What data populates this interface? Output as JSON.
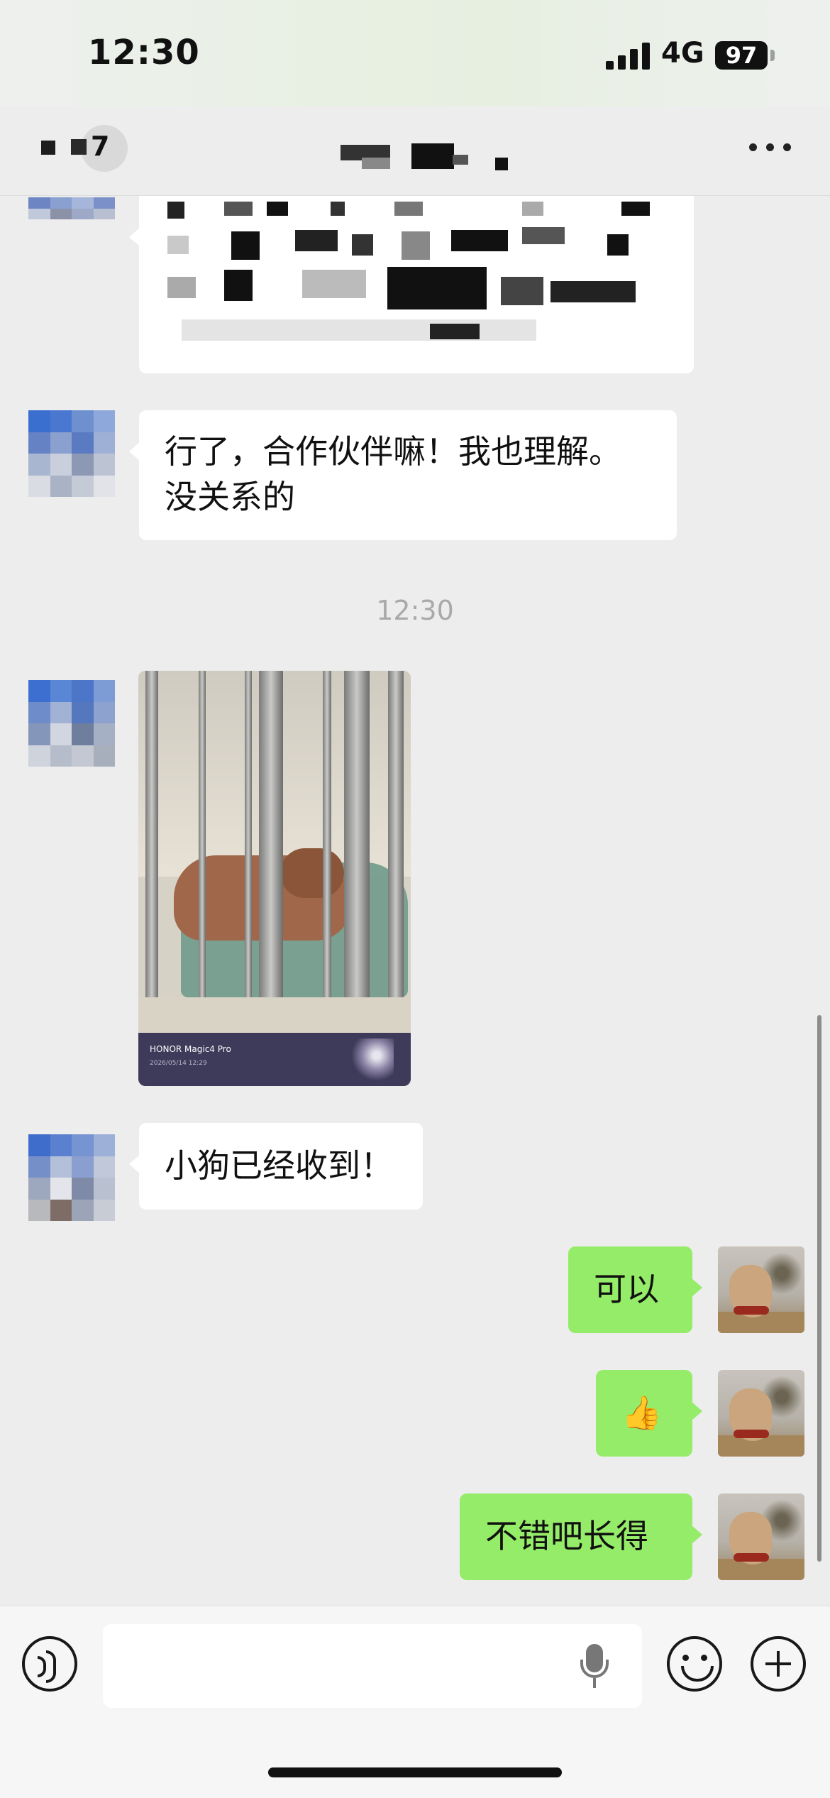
{
  "status_bar": {
    "time": "12:30",
    "network": "4G",
    "battery": "97"
  },
  "nav": {
    "back_count": "7",
    "more_icon": "ellipsis-icon"
  },
  "messages": {
    "m1_text": "行了，合作伙伴嘛！我也理解。\n没关系的",
    "timestamp": "12:30",
    "photo_brand": "HONOR Magic4 Pro",
    "photo_stamp": "2026/05/14 12:29",
    "m3_text": "小狗已经收到！",
    "r1_text": "可以",
    "r2_text": "👍",
    "r3_text": "不错吧长得"
  },
  "input_bar": {
    "voice_icon": "voice-icon",
    "mic_icon": "microphone-icon",
    "emoji_icon": "emoji-icon",
    "add_icon": "add-icon"
  },
  "colors": {
    "bubble_self": "#95ec69",
    "bubble_other": "#ffffff",
    "background": "#ededed"
  }
}
